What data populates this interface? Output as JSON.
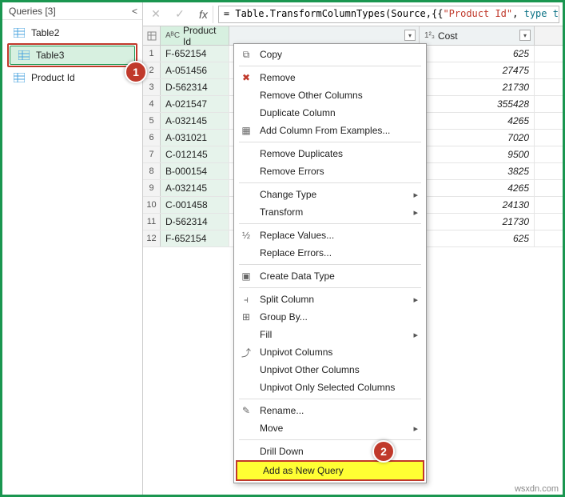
{
  "queries": {
    "header": "Queries [3]",
    "items": [
      {
        "label": "Table2"
      },
      {
        "label": "Table3"
      },
      {
        "label": "Product Id"
      }
    ]
  },
  "formula": {
    "prefix": "= Table.TransformColumnTypes(Source,{{",
    "str": "\"Product Id\"",
    "mid": ", ",
    "typ": "type tex"
  },
  "columns": {
    "product_id": "Product Id",
    "cost": "Cost",
    "type_text": "AᴮC",
    "type_num": "1²₃"
  },
  "rows": [
    {
      "n": "1",
      "pid": "F-652154",
      "cost": "625"
    },
    {
      "n": "2",
      "pid": "A-051456",
      "cost": "27475"
    },
    {
      "n": "3",
      "pid": "D-562314",
      "cost": "21730"
    },
    {
      "n": "4",
      "pid": "A-021547",
      "cost": "355428"
    },
    {
      "n": "5",
      "pid": "A-032145",
      "cost": "4265"
    },
    {
      "n": "6",
      "pid": "A-031021",
      "cost": "7020"
    },
    {
      "n": "7",
      "pid": "C-012145",
      "cost": "9500"
    },
    {
      "n": "8",
      "pid": "B-000154",
      "cost": "3825"
    },
    {
      "n": "9",
      "pid": "A-032145",
      "cost": "4265"
    },
    {
      "n": "10",
      "pid": "C-001458",
      "cost": "24130"
    },
    {
      "n": "11",
      "pid": "D-562314",
      "cost": "21730"
    },
    {
      "n": "12",
      "pid": "F-652154",
      "cost": "625"
    }
  ],
  "ctx": {
    "copy": "Copy",
    "remove": "Remove",
    "remove_other": "Remove Other Columns",
    "duplicate": "Duplicate Column",
    "add_examples": "Add Column From Examples...",
    "remove_dup": "Remove Duplicates",
    "remove_err": "Remove Errors",
    "change_type": "Change Type",
    "transform": "Transform",
    "replace_values": "Replace Values...",
    "replace_errors": "Replace Errors...",
    "create_data_type": "Create Data Type",
    "split": "Split Column",
    "group": "Group By...",
    "fill": "Fill",
    "unpivot": "Unpivot Columns",
    "unpivot_other": "Unpivot Other Columns",
    "unpivot_sel": "Unpivot Only Selected Columns",
    "rename": "Rename...",
    "move": "Move",
    "drill": "Drill Down",
    "add_query": "Add as New Query"
  },
  "badges": {
    "b1": "1",
    "b2": "2"
  },
  "watermark": "wsxdn.com"
}
